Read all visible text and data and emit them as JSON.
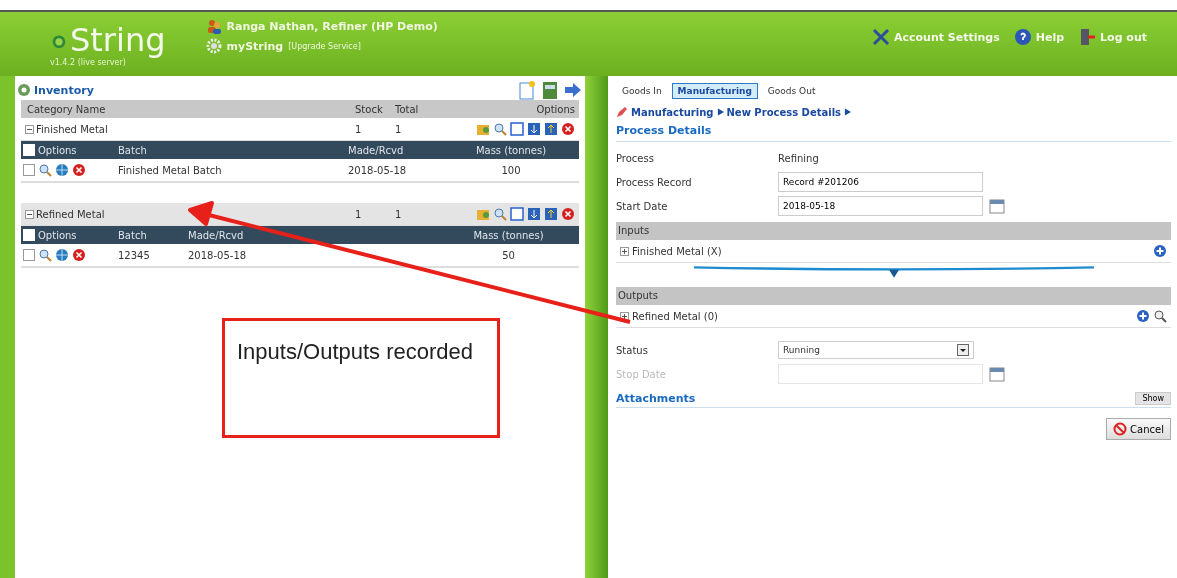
{
  "header": {
    "logo": "String",
    "version": "v1.4.2 (live server)",
    "user": "Ranga Nathan, Refiner (HP Demo)",
    "service": "myString",
    "upgrade": "[Upgrade Service]",
    "links": [
      "Account Settings",
      "Help",
      "Log out"
    ]
  },
  "inventory": {
    "title": "Inventory",
    "columns": [
      "Category Name",
      "Stock",
      "Total",
      "Options"
    ],
    "categories": [
      {
        "name": "Finished Metal",
        "stock": "1",
        "total": "1",
        "expanded": true,
        "all_checked": false,
        "batch_columns": [
          "Options",
          "Batch",
          "Made/Rcvd",
          "Mass (tonnes)"
        ],
        "batches": [
          {
            "batch": "Finished Metal Batch",
            "date": "2018-05-18",
            "mass": "100",
            "checked": false
          }
        ]
      },
      {
        "name": "Refined Metal",
        "stock": "1",
        "total": "1",
        "expanded": true,
        "all_checked": false,
        "batch_columns": [
          "Options",
          "Batch",
          "Made/Rcvd",
          "Mass (tonnes)"
        ],
        "batches": [
          {
            "batch": "12345",
            "date": "2018-05-18",
            "mass": "50",
            "checked": false
          }
        ]
      }
    ]
  },
  "tabs": [
    {
      "label": "Goods In",
      "selected": false
    },
    {
      "label": "Manufacturing",
      "selected": true
    },
    {
      "label": "Goods Out",
      "selected": false
    }
  ],
  "breadcrumb": [
    "Manufacturing",
    "New Process Details"
  ],
  "process": {
    "title": "Process Details",
    "fields": [
      {
        "kind": "text",
        "label": "Process",
        "value": "Refining"
      },
      {
        "kind": "input",
        "label": "Process Record",
        "value": "Record #201206"
      },
      {
        "kind": "date",
        "label": "Start Date",
        "value": "2018-05-18"
      }
    ],
    "inputs": {
      "title": "Inputs",
      "items": [
        {
          "label": "Finished Metal (X)",
          "expanded": false
        }
      ]
    },
    "outputs": {
      "title": "Outputs",
      "items": [
        {
          "label": "Refined Metal (0)",
          "expanded": false
        }
      ]
    },
    "fields2": [
      {
        "kind": "select",
        "label": "Status",
        "value": "Running"
      },
      {
        "kind": "date",
        "label": "Stop Date",
        "disabled": true
      }
    ],
    "attachments": "Attachments",
    "show": "Show",
    "cancel": "Cancel"
  },
  "annotation": {
    "text": "Inputs/Outputs recorded"
  }
}
